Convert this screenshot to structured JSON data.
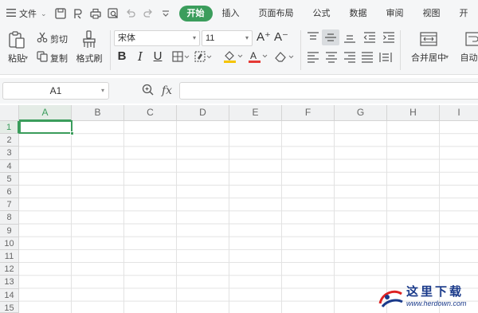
{
  "menu": {
    "file_label": "文件",
    "tabs": [
      "开始",
      "插入",
      "页面布局",
      "公式",
      "数据",
      "审阅",
      "视图",
      "开"
    ],
    "active_tab_index": 0
  },
  "ribbon": {
    "paste_label": "粘贴",
    "cut_label": "剪切",
    "copy_label": "复制",
    "format_painter_label": "格式刷",
    "font_name": "宋体",
    "font_size": "11",
    "merge_center_label": "合并居中",
    "auto_wrap_label": "自动换",
    "glyphs": {
      "grow_font": "A⁺",
      "shrink_font": "A⁻",
      "bold": "B",
      "italic": "I",
      "underline": "U"
    }
  },
  "formula_bar": {
    "name_box": "A1",
    "fx_label": "fx",
    "value": ""
  },
  "grid": {
    "columns": [
      "A",
      "B",
      "C",
      "D",
      "E",
      "F",
      "G",
      "H",
      "I"
    ],
    "rows": [
      "1",
      "2",
      "3",
      "4",
      "5",
      "6",
      "7",
      "8",
      "9",
      "10",
      "11",
      "12",
      "13",
      "14",
      "15"
    ],
    "active_cell": "A1"
  },
  "watermark": {
    "title": "这里下载",
    "url": "www.herdown.com"
  },
  "colors": {
    "accent": "#3b9d5c",
    "toolbar_bg": "#f5f6f7",
    "header_bg": "#f0f1f2",
    "gridline": "#e2e2e2",
    "font_color_underline": "#e53935",
    "fill_color_underline": "#f5c400"
  }
}
